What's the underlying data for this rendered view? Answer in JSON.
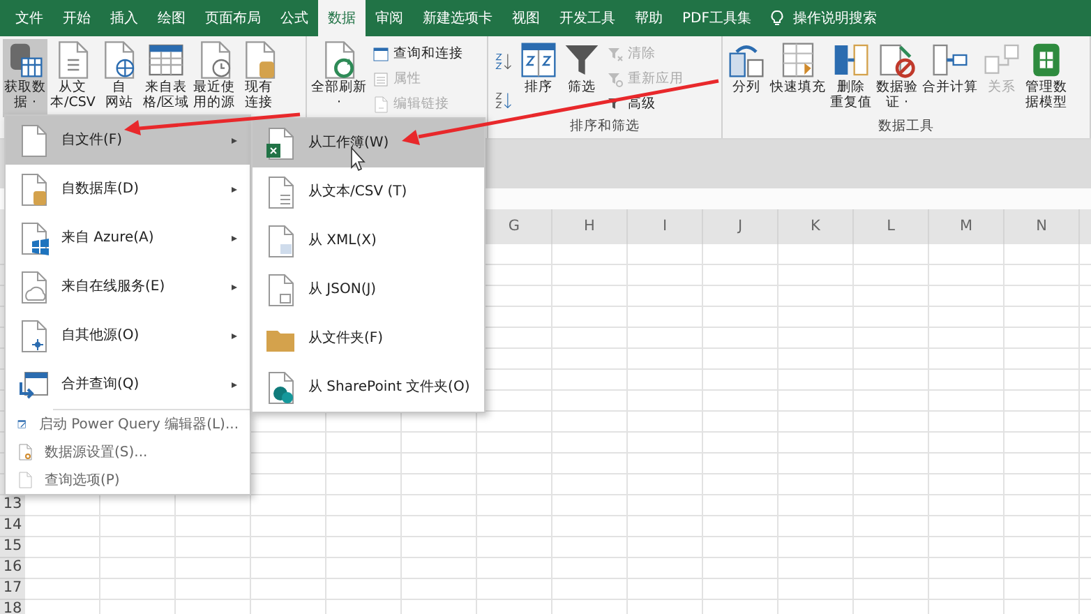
{
  "tabs": [
    {
      "label": "文件",
      "selected": false
    },
    {
      "label": "开始",
      "selected": false
    },
    {
      "label": "插入",
      "selected": false
    },
    {
      "label": "绘图",
      "selected": false
    },
    {
      "label": "页面布局",
      "selected": false
    },
    {
      "label": "公式",
      "selected": false
    },
    {
      "label": "数据",
      "selected": true
    },
    {
      "label": "审阅",
      "selected": false
    },
    {
      "label": "新建选项卡",
      "selected": false
    },
    {
      "label": "视图",
      "selected": false
    },
    {
      "label": "开发工具",
      "selected": false
    },
    {
      "label": "帮助",
      "selected": false
    },
    {
      "label": "PDF工具集",
      "selected": false
    }
  ],
  "tell_me": "操作说明搜索",
  "ribbon_groups": [
    {
      "buttons": [
        {
          "kind": "large",
          "lines": [
            "获取数",
            "据 ·"
          ],
          "pressed": true
        },
        {
          "kind": "large",
          "lines": [
            "从文",
            "本/CSV"
          ],
          "pressed": false
        },
        {
          "kind": "large",
          "lines": [
            "自",
            "网站"
          ],
          "pressed": false
        },
        {
          "kind": "large",
          "lines": [
            "来自表",
            "格/区域"
          ],
          "pressed": false
        },
        {
          "kind": "large",
          "lines": [
            "最近使",
            "用的源"
          ],
          "pressed": false
        },
        {
          "kind": "large",
          "lines": [
            "现有",
            "连接"
          ],
          "pressed": false
        }
      ]
    },
    {
      "buttons": [
        {
          "kind": "large",
          "lines": [
            "全部刷新",
            "·"
          ],
          "pressed": false
        },
        {
          "kind": "small",
          "label": "查询和连接",
          "disabled": false
        },
        {
          "kind": "small",
          "label": "属性",
          "disabled": true
        },
        {
          "kind": "small",
          "label": "编辑链接",
          "disabled": true
        }
      ]
    },
    {
      "label": "排序和筛选",
      "buttons": [
        {
          "kind": "sortpair"
        },
        {
          "kind": "large",
          "lines": [
            "排序"
          ],
          "pressed": false
        },
        {
          "kind": "large",
          "lines": [
            "筛选"
          ],
          "pressed": false
        },
        {
          "kind": "small",
          "label": "清除",
          "disabled": true
        },
        {
          "kind": "small",
          "label": "重新应用",
          "disabled": true
        },
        {
          "kind": "small",
          "label": "高级",
          "disabled": false
        }
      ]
    },
    {
      "label": "数据工具",
      "buttons": [
        {
          "kind": "large",
          "lines": [
            "分列"
          ],
          "pressed": false
        },
        {
          "kind": "large",
          "lines": [
            "快速填充"
          ],
          "pressed": false
        },
        {
          "kind": "large",
          "lines": [
            "删除",
            "重复值"
          ],
          "pressed": false
        },
        {
          "kind": "large",
          "lines": [
            "数据验",
            "证 ·"
          ],
          "pressed": false
        },
        {
          "kind": "large",
          "lines": [
            "合并计算"
          ],
          "pressed": false
        },
        {
          "kind": "large",
          "lines": [
            "关系"
          ],
          "pressed": false,
          "disabled": true
        },
        {
          "kind": "large",
          "lines": [
            "管理数",
            "据模型"
          ],
          "pressed": false
        }
      ]
    }
  ],
  "columns": [
    "G",
    "H",
    "I",
    "J",
    "K",
    "L",
    "M",
    "N"
  ],
  "row_headers": [
    "13",
    "14",
    "15",
    "16",
    "17",
    "18"
  ],
  "get_data_menu": [
    {
      "kind": "submenu",
      "label": "自文件(F)",
      "selected": true
    },
    {
      "kind": "submenu",
      "label": "自数据库(D)",
      "selected": false
    },
    {
      "kind": "submenu",
      "label": "来自 Azure(A)",
      "selected": false
    },
    {
      "kind": "submenu",
      "label": "来自在线服务(E)",
      "selected": false
    },
    {
      "kind": "submenu",
      "label": "自其他源(O)",
      "selected": false
    },
    {
      "kind": "submenu",
      "label": "合并查询(Q)",
      "selected": false
    },
    {
      "kind": "command",
      "label": "启动 Power Query 编辑器(L)...",
      "selected": false
    },
    {
      "kind": "command",
      "label": "数据源设置(S)...",
      "selected": false
    },
    {
      "kind": "command",
      "label": "查询选项(P)",
      "selected": false
    }
  ],
  "from_file_menu": [
    {
      "label": "从工作簿(W)",
      "selected": true
    },
    {
      "label": "从文本/CSV (T)",
      "selected": false
    },
    {
      "label": "从 XML(X)",
      "selected": false
    },
    {
      "label": "从 JSON(J)",
      "selected": false
    },
    {
      "label": "从文件夹(F)",
      "selected": false
    },
    {
      "label": "从 SharePoint 文件夹(O)",
      "selected": false
    }
  ]
}
